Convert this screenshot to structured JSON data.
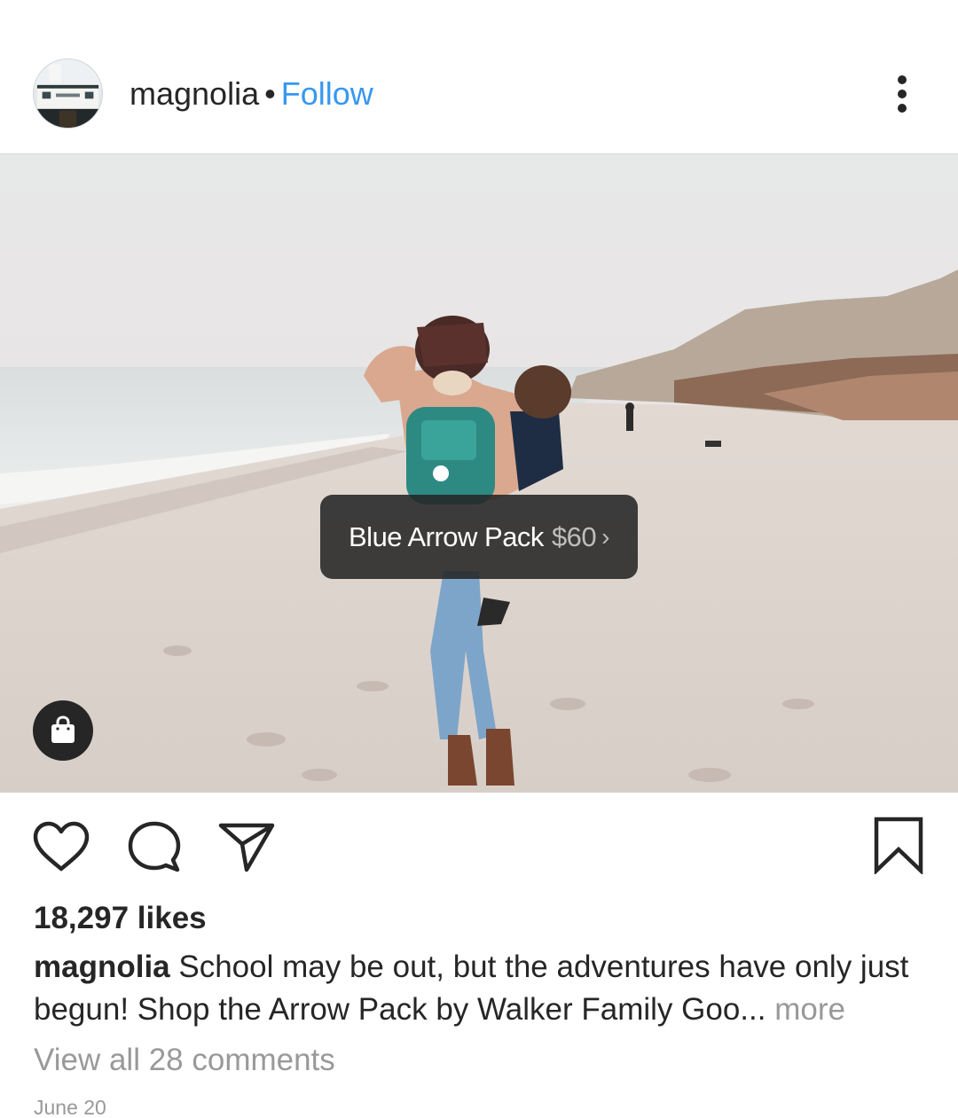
{
  "post": {
    "username": "magnolia",
    "separator": "•",
    "follow_label": "Follow",
    "more_icon": "more-vertical-icon"
  },
  "photo": {
    "product_tag": {
      "name": "Blue Arrow Pack",
      "price": "$60",
      "chevron": "›"
    },
    "shop_icon": "shopping-bag-icon"
  },
  "actions": {
    "like_icon": "heart-icon",
    "comment_icon": "comment-icon",
    "share_icon": "paper-plane-icon",
    "save_icon": "bookmark-icon"
  },
  "likes_text": "18,297 likes",
  "caption": {
    "username": "magnolia",
    "text": "School may be out, but the adventures have only just begun! Shop the Arrow Pack by Walker Family Goo",
    "ellipsis": "...",
    "more_label": "more"
  },
  "view_comments_label": "View all 28 comments",
  "date": "June 20",
  "colors": {
    "link_blue": "#3897f0",
    "text": "#262626",
    "secondary": "#999999"
  }
}
